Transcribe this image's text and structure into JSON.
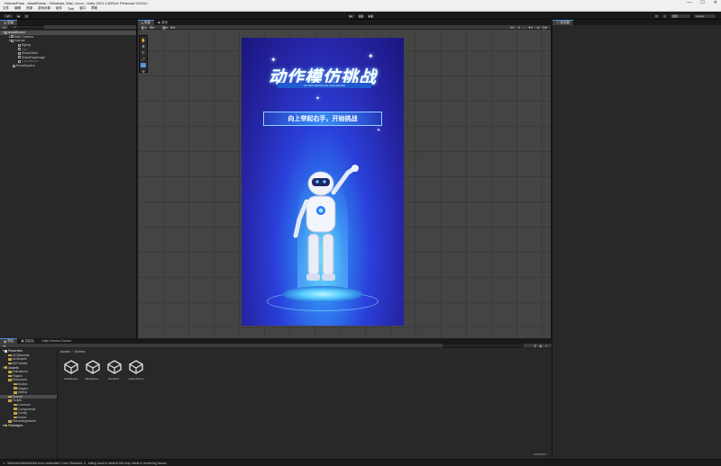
{
  "window": {
    "title": "HumanPose - AwaitScene - Windows, Mac, Linux - Unity 2021.2.62f1c1 Personal <DX11>",
    "controls": [
      "—",
      "☐",
      "✕"
    ]
  },
  "menu": [
    "文件",
    "编辑",
    "资源",
    "游戏对象",
    "组件",
    "Tobii",
    "窗口",
    "帮助"
  ],
  "toolbar": {
    "layers_label": "图层",
    "layout_label": "Layout"
  },
  "hierarchy": {
    "tab_label": "层级",
    "search_placeholder": "All",
    "items": [
      {
        "label": "AwaitScene",
        "depth": 0,
        "expanded": true,
        "selected": true
      },
      {
        "label": "Main Camera",
        "depth": 1,
        "expanded": false
      },
      {
        "label": "Canvas",
        "depth": 1,
        "expanded": true
      },
      {
        "label": "Bgimg",
        "depth": 2
      },
      {
        "label": "Tips",
        "depth": 2,
        "dim": true
      },
      {
        "label": "RobotVideo",
        "depth": 2
      },
      {
        "label": "RobotRawImage",
        "depth": 2
      },
      {
        "label": "CloseButton",
        "depth": 2,
        "dim": true
      },
      {
        "label": "EventSystem",
        "depth": 1
      }
    ]
  },
  "scene_view": {
    "tabs": [
      "场景",
      "游戏"
    ],
    "game_image": {
      "title": "动作模仿挑战",
      "subtitle": "ACTION IMITATION CHALLENGE",
      "banner": "向上举起右手，开始挑战"
    }
  },
  "inspector": {
    "tab_label": "检查器"
  },
  "bottom": {
    "tabs": [
      "项目",
      "控制台",
      "Unity Version Control"
    ],
    "breadcrumb": [
      "Assets",
      "Scenes"
    ],
    "tree": [
      {
        "label": "Favorites",
        "depth": 0,
        "bold": true
      },
      {
        "label": "All Materials",
        "depth": 1
      },
      {
        "label": "All Models",
        "depth": 1
      },
      {
        "label": "All Prefabs",
        "depth": 1
      },
      {
        "label": "Assets",
        "depth": 0,
        "bold": true
      },
      {
        "label": "Animations",
        "depth": 1
      },
      {
        "label": "Plugins",
        "depth": 1
      },
      {
        "label": "Resources",
        "depth": 1
      },
      {
        "label": "Audios",
        "depth": 2
      },
      {
        "label": "Images",
        "depth": 2
      },
      {
        "label": "Videos",
        "depth": 2
      },
      {
        "label": "Scenes",
        "depth": 1,
        "selected": true
      },
      {
        "label": "Scripts",
        "depth": 1
      },
      {
        "label": "Common",
        "depth": 2
      },
      {
        "label": "Components",
        "depth": 2
      },
      {
        "label": "Config",
        "depth": 2
      },
      {
        "label": "Scene",
        "depth": 2
      },
      {
        "label": "StreamingAssets",
        "depth": 1
      },
      {
        "label": "Packages",
        "depth": 0,
        "bold": true
      }
    ],
    "assets": [
      "AwaitScene",
      "Backgroun...",
      "InteractS...",
      "GameScene"
    ]
  },
  "status": {
    "message": "WindowsVideoMedia error unhandled Color Standard: 0 - falling back to default this may result in rendering issues"
  },
  "colors": {
    "accent": "#4d8ee0",
    "warning": "#e6c84d"
  }
}
